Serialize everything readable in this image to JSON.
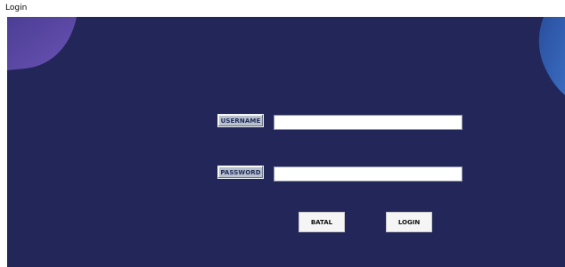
{
  "window": {
    "title": "Login"
  },
  "form": {
    "username_label": "USERNAME",
    "username_value": "",
    "password_label": "PASSWORD",
    "password_value": ""
  },
  "buttons": {
    "cancel_label": "BATAL",
    "login_label": "LOGIN"
  },
  "colors": {
    "background": "#222658",
    "decoration_left": "#5a4aa0",
    "decoration_right": "#2d5aa8",
    "label_background": "#b8c0cc"
  }
}
